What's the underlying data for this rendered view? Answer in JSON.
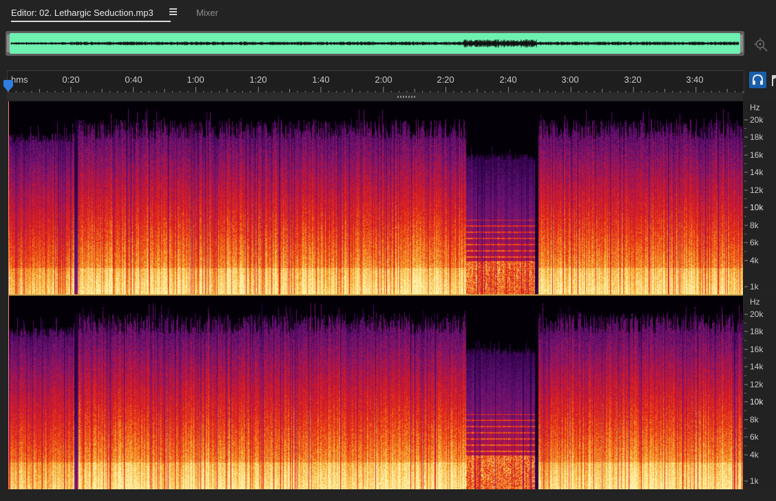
{
  "tabs": {
    "editor_label": "Editor: 02. Lethargic Seduction.mp3",
    "mixer_label": "Mixer"
  },
  "colors": {
    "waveform_fill": "#6ef0b0",
    "waveform_trace": "#111111",
    "accent_blue": "#1b5ea9",
    "cursor": "#ff7f6a",
    "channel_separator": "#caa24a"
  },
  "timeline": {
    "unit_label": "hms",
    "labels": [
      "0:20",
      "0:40",
      "1:00",
      "1:20",
      "1:40",
      "2:00",
      "2:20",
      "2:40",
      "3:00",
      "3:20",
      "3:40"
    ]
  },
  "frequency_ruler": {
    "unit_label": "Hz",
    "labels": [
      "20k",
      "18k",
      "16k",
      "14k",
      "12k",
      "10k",
      "8k",
      "6k",
      "4k",
      "1k"
    ],
    "emphasized": "10k"
  },
  "icons": {
    "zoom": "zoom-target-icon",
    "headphones": "headphones-icon",
    "menu": "hamburger-menu-icon",
    "playhead": "playhead-marker-icon"
  }
}
